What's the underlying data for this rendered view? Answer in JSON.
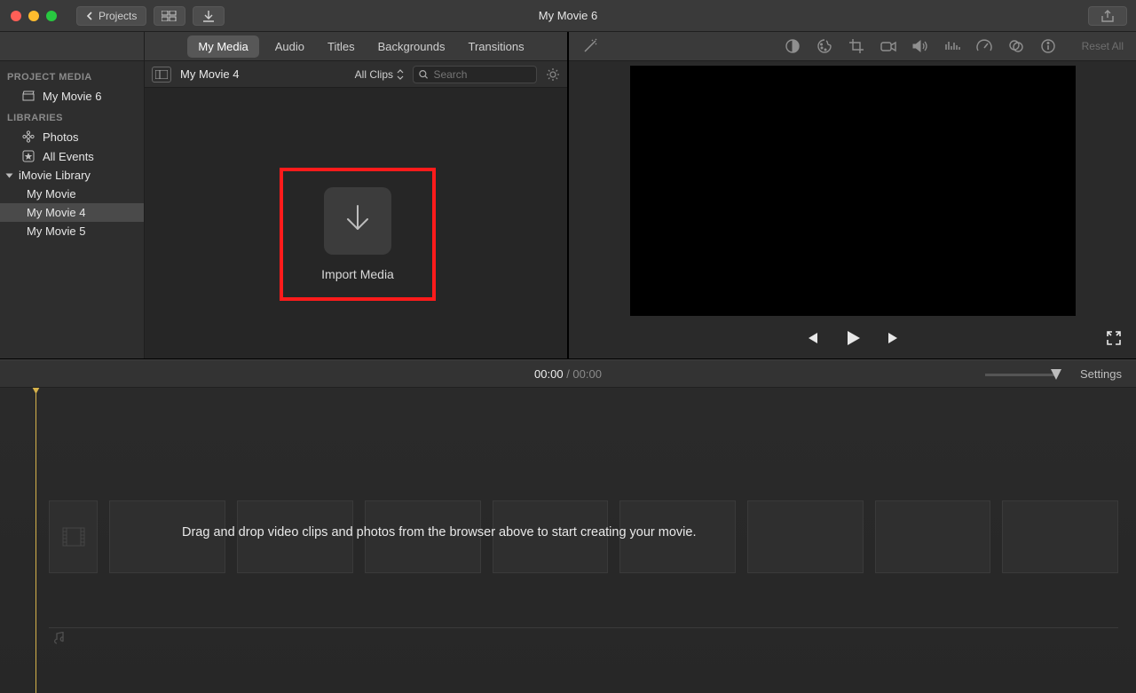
{
  "window": {
    "title": "My Movie 6",
    "back_label": "Projects"
  },
  "tabs": {
    "my_media": "My Media",
    "audio": "Audio",
    "titles": "Titles",
    "backgrounds": "Backgrounds",
    "transitions": "Transitions"
  },
  "sidebar": {
    "project_media_header": "PROJECT MEDIA",
    "project_name": "My Movie 6",
    "libraries_header": "LIBRARIES",
    "photos": "Photos",
    "all_events": "All Events",
    "imovie_library": "iMovie Library",
    "items": [
      {
        "label": "My Movie"
      },
      {
        "label": "My Movie 4"
      },
      {
        "label": "My Movie 5"
      }
    ]
  },
  "browser": {
    "event_name": "My Movie 4",
    "clips_filter": "All Clips",
    "search_placeholder": "Search",
    "import_label": "Import Media"
  },
  "viewer": {
    "reset_label": "Reset All"
  },
  "timeline": {
    "current": "00:00",
    "total": "00:00",
    "settings_label": "Settings",
    "empty_hint": "Drag and drop video clips and photos from the browser above to start creating your movie."
  }
}
